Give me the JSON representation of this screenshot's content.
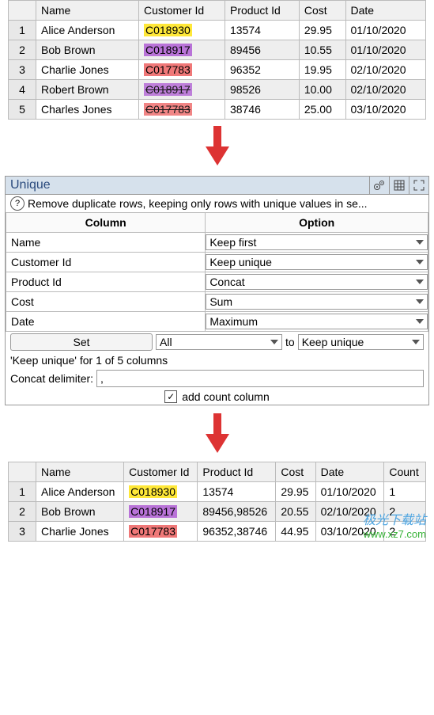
{
  "t1": {
    "h": [
      "",
      "Name",
      "Customer Id",
      "Product Id",
      "Cost",
      "Date"
    ],
    "r": [
      [
        "1",
        "Alice Anderson",
        "C018930",
        "13574",
        "29.95",
        "01/10/2020"
      ],
      [
        "2",
        "Bob Brown",
        "C018917",
        "89456",
        "10.55",
        "01/10/2020"
      ],
      [
        "3",
        "Charlie Jones",
        "C017783",
        "96352",
        "19.95",
        "02/10/2020"
      ],
      [
        "4",
        "Robert Brown",
        "C018917",
        "98526",
        "10.00",
        "02/10/2020"
      ],
      [
        "5",
        "Charles Jones",
        "C017783",
        "38746",
        "25.00",
        "03/10/2020"
      ]
    ],
    "cls": [
      "hl-y",
      "hl-p",
      "hl-r",
      "hl-p",
      "hl-r"
    ],
    "strike": [
      false,
      false,
      false,
      true,
      true
    ]
  },
  "panel": {
    "title": "Unique",
    "help": "Remove duplicate rows, keeping only rows with unique values in se...",
    "colH": "Column",
    "optH": "Option",
    "rows": [
      [
        "Name",
        "Keep first"
      ],
      [
        "Customer Id",
        "Keep unique"
      ],
      [
        "Product Id",
        "Concat"
      ],
      [
        "Cost",
        "Sum"
      ],
      [
        "Date",
        "Maximum"
      ]
    ],
    "set": "Set",
    "all": "All",
    "to": "to",
    "keep": "Keep unique",
    "summary": "'Keep unique' for 1 of 5 columns",
    "delim_lbl": "Concat delimiter:",
    "delim": ",",
    "chk": "add count column"
  },
  "t2": {
    "h": [
      "",
      "Name",
      "Customer Id",
      "Product Id",
      "Cost",
      "Date",
      "Count"
    ],
    "r": [
      [
        "1",
        "Alice Anderson",
        "C018930",
        "13574",
        "29.95",
        "01/10/2020",
        "1"
      ],
      [
        "2",
        "Bob Brown",
        "C018917",
        "89456,98526",
        "20.55",
        "02/10/2020",
        "2"
      ],
      [
        "3",
        "Charlie Jones",
        "C017783",
        "96352,38746",
        "44.95",
        "03/10/2020",
        "2"
      ]
    ],
    "cls": [
      "hl-y",
      "hl-p",
      "hl-r"
    ]
  },
  "wm": {
    "a": "极光下载站",
    "b": "www.xz7.com"
  }
}
